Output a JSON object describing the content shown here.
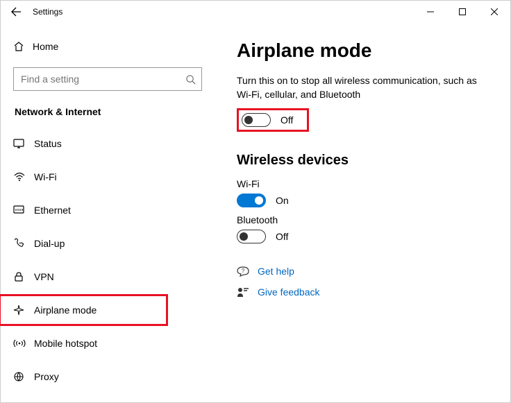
{
  "titlebar": {
    "title": "Settings"
  },
  "sidebar": {
    "home": "Home",
    "search_placeholder": "Find a setting",
    "category": "Network & Internet",
    "items": [
      {
        "label": "Status"
      },
      {
        "label": "Wi-Fi"
      },
      {
        "label": "Ethernet"
      },
      {
        "label": "Dial-up"
      },
      {
        "label": "VPN"
      },
      {
        "label": "Airplane mode"
      },
      {
        "label": "Mobile hotspot"
      },
      {
        "label": "Proxy"
      }
    ]
  },
  "content": {
    "title": "Airplane mode",
    "description": "Turn this on to stop all wireless communication, such as Wi-Fi, cellular, and Bluetooth",
    "airplane_toggle_state": "Off",
    "section_wireless": "Wireless devices",
    "wifi_label": "Wi-Fi",
    "wifi_state": "On",
    "bluetooth_label": "Bluetooth",
    "bluetooth_state": "Off",
    "get_help": "Get help",
    "give_feedback": "Give feedback"
  }
}
